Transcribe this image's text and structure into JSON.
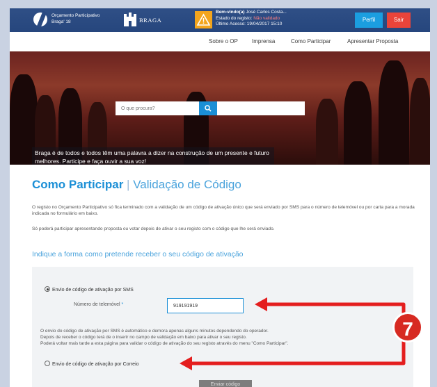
{
  "header": {
    "logo_text": "Orçamento Participativo Braga' 18",
    "city_logo_text": "BRAGA",
    "welcome_label": "Bem-vindo(a)",
    "user_name": "José Carlos Costa...",
    "registration_label": "Estado do registo:",
    "registration_status": "Não validado",
    "last_access": "Último Acesso: 19/04/2017 15:10",
    "profile_button": "Perfil",
    "logout_button": "Sair"
  },
  "nav": {
    "items": [
      "Sobre o OP",
      "Imprensa",
      "Como Participar",
      "Apresentar Proposta"
    ]
  },
  "hero": {
    "search_placeholder": "O que procura?",
    "caption": "Braga é de todos e todos têm uma palavra a dizer na construção de um presente e futuro melhores. Participe e faça ouvir a sua voz!"
  },
  "content": {
    "title_main": "Como Participar",
    "title_separator": "|",
    "title_sub": "Validação de Código",
    "paragraph_1": "O registo no Orçamento Participativo só fica terminado com a validação de um código de ativação único que será enviado por SMS para o número de telemóvel ou por carta para a morada indicada no formulário em baixo.",
    "paragraph_2": "Só poderá participar apresentando proposta ou votar depois de ativar o seu registo com o código que lhe será enviado.",
    "section_title": "Indique a forma como pretende receber o seu código de ativação"
  },
  "form": {
    "sms_option": "Envio de código de ativação por SMS",
    "sms_selected": true,
    "phone_label": "Número de telemóvel",
    "phone_required_mark": "*",
    "phone_value": "919191919",
    "sms_info_1": "O envio do código de ativação por SMS é automático e demora apenas alguns minutos dependendo do operador.",
    "sms_info_2": "Depois de receber o código terá de o inserir no campo de validação em baixo para ativar o seu registo.",
    "sms_info_3": "Poderá voltar mais tarde a esta página para validar o código de ativação do seu registo através do menu \"Como Participar\".",
    "mail_option": "Envio de código de ativação por Correio",
    "mail_selected": false,
    "submit_button": "Enviar código"
  },
  "annotation": {
    "step_number": "7",
    "arrow_color": "#e41e1e"
  },
  "colors": {
    "header_blue": "#2a4a82",
    "accent_blue": "#1b8fd6",
    "logout_red": "#e9443a",
    "warning_orange": "#f3a51d"
  }
}
